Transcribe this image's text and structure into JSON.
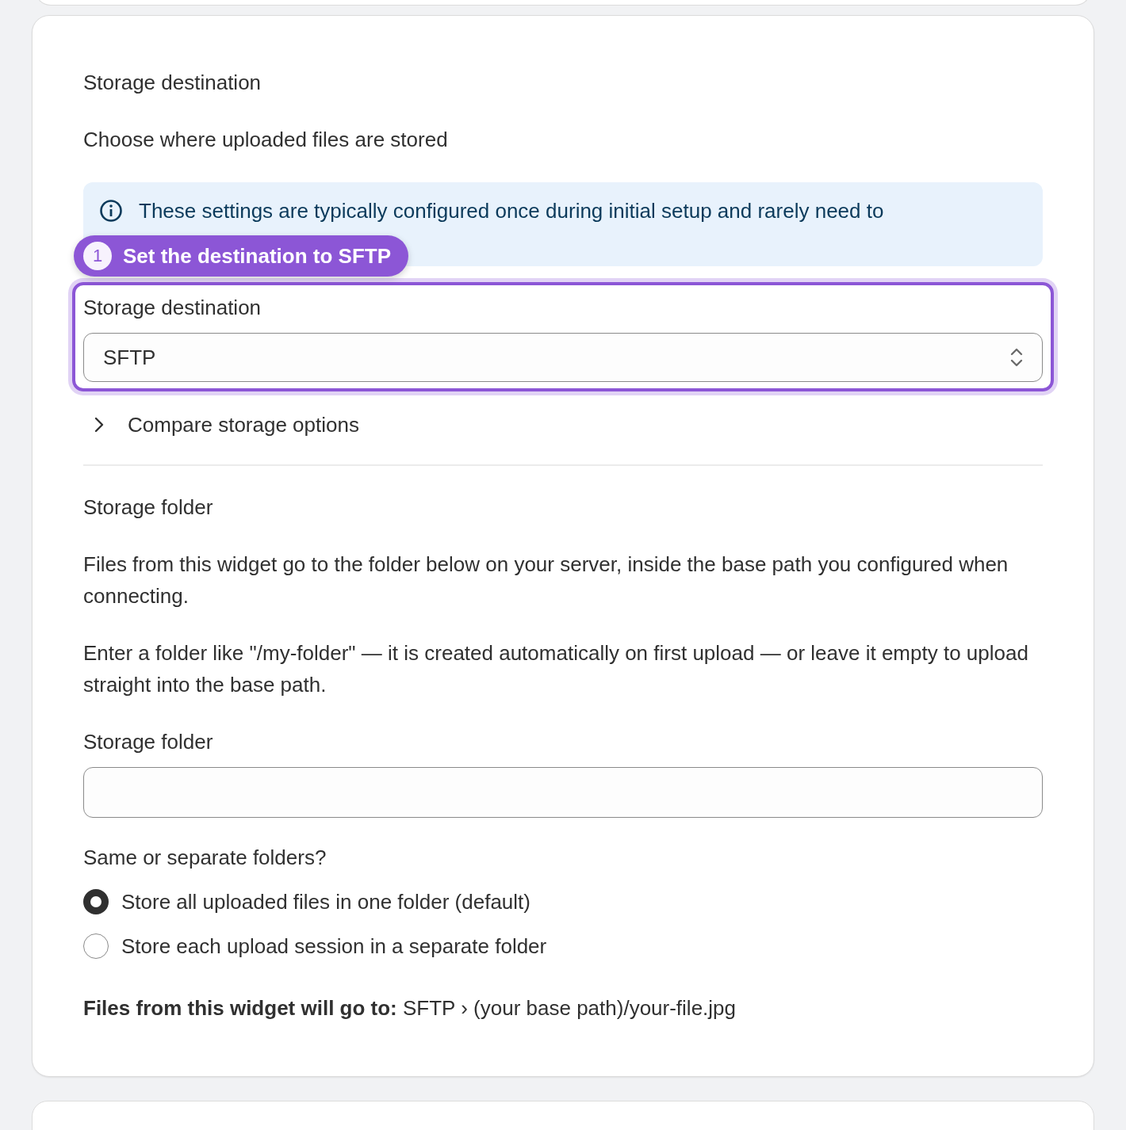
{
  "destination_section": {
    "title": "Storage destination",
    "description": "Choose where uploaded files are stored",
    "info_banner": "These settings are typically configured once during initial setup and rarely need to",
    "callout": {
      "number": "1",
      "text": "Set the destination to SFTP"
    },
    "select": {
      "label": "Storage destination",
      "value": "SFTP"
    },
    "disclosure": {
      "label": "Compare storage options",
      "expanded": false
    }
  },
  "folder_section": {
    "title": "Storage folder",
    "paragraphs": [
      "Files from this widget go to the folder below on your server, inside the base path you configured when connecting.",
      "Enter a folder like \"/my-folder\" — it is created automatically on first upload — or leave it empty to upload straight into the base path."
    ],
    "field": {
      "label": "Storage folder"
    },
    "question": "Same or separate folders?",
    "options": [
      {
        "label": "Store all uploaded files in one folder (default)",
        "selected": true
      },
      {
        "label": "Store each upload session in a separate folder",
        "selected": false
      }
    ],
    "summary": "**Files from this widget will go to:** SFTP › (your base path)/your-file.jpg"
  }
}
